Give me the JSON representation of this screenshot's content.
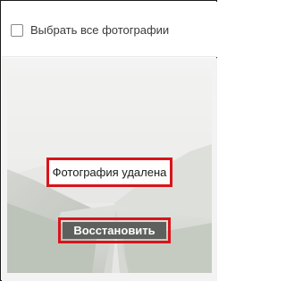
{
  "select_all": {
    "label": "Выбрать все фотографии",
    "checked": false
  },
  "photo": {
    "status_text": "Фотография удалена",
    "restore_label": "Восстановить",
    "highlight_color": "#d9141b",
    "restore_button_color": "#5e605e"
  }
}
